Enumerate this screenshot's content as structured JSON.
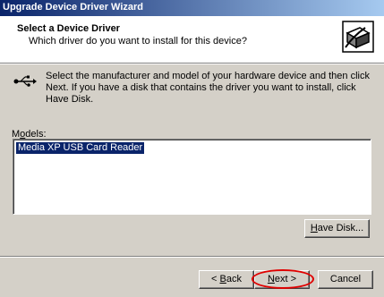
{
  "window": {
    "title": "Upgrade Device Driver Wizard"
  },
  "header": {
    "title": "Select a Device Driver",
    "subtitle": "Which driver do you want to install for this device?",
    "icon": "hardware-wizard-icon"
  },
  "description": {
    "icon": "usb-icon",
    "text": "Select the manufacturer and model of your hardware device and then click Next. If you have a disk that contains the driver you want to install, click Have Disk."
  },
  "models": {
    "label_pre": "M",
    "label_accel": "o",
    "label_post": "dels:",
    "items": [
      "Media XP USB Card Reader"
    ]
  },
  "buttons": {
    "have_disk_accel": "H",
    "have_disk_rest": "ave Disk...",
    "back_prefix": "< ",
    "back_accel": "B",
    "back_rest": "ack",
    "next_accel": "N",
    "next_rest": "ext >",
    "cancel": "Cancel"
  },
  "colors": {
    "highlight_annotation": "#e00000",
    "selection": "#0a246a"
  }
}
